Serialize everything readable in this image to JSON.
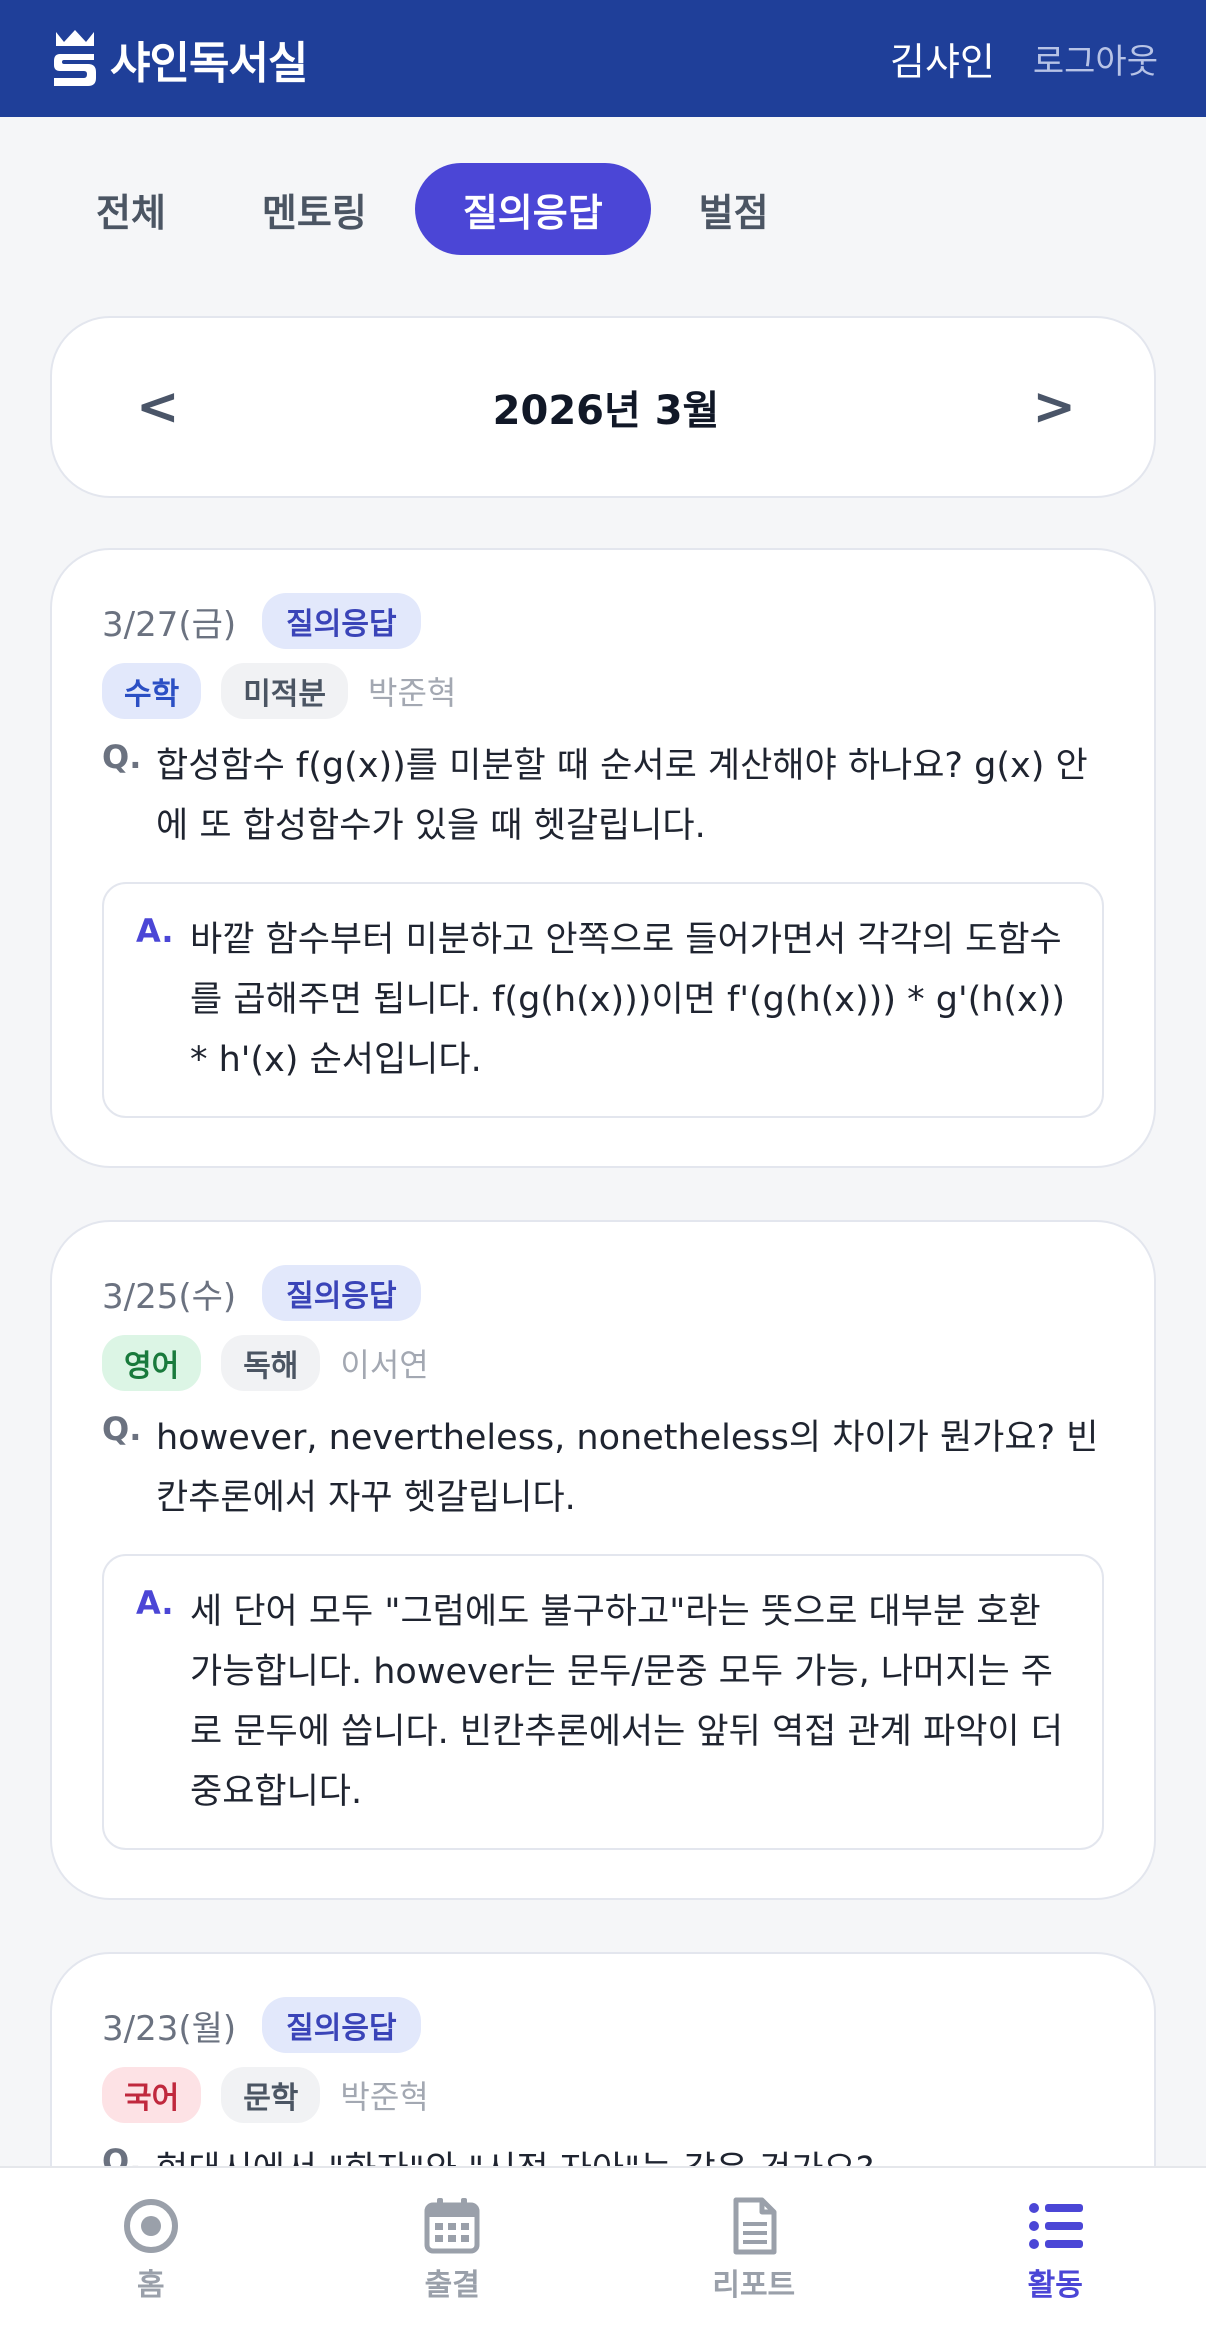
{
  "header": {
    "brand": "샤인독서실",
    "user_name": "김샤인",
    "logout": "로그아웃"
  },
  "tabs": [
    {
      "label": "전체",
      "active": false
    },
    {
      "label": "멘토링",
      "active": false
    },
    {
      "label": "질의응답",
      "active": true
    },
    {
      "label": "벌점",
      "active": false
    }
  ],
  "month": {
    "label": "2026년 3월",
    "prev": "<",
    "next": ">"
  },
  "cards": [
    {
      "date": "3/27(금)",
      "type": "질의응답",
      "subject": "수학",
      "topic": "미적분",
      "mentor": "박준혁",
      "q_mark": "Q.",
      "question": "합성함수 f(g(x))를 미분할 때 순서로 계산해야 하나요? g(x) 안에 또 합성함수가 있을 때 헷갈립니다.",
      "a_mark": "A.",
      "answer": "바깥 함수부터 미분하고 안쪽으로 들어가면서 각각의 도함수를 곱해주면 됩니다. f(g(h(x)))이면 f'(g(h(x))) * g'(h(x)) * h'(x) 순서입니다."
    },
    {
      "date": "3/25(수)",
      "type": "질의응답",
      "subject": "영어",
      "topic": "독해",
      "mentor": "이서연",
      "q_mark": "Q.",
      "question": "however, nevertheless, nonetheless의 차이가 뭔가요? 빈칸추론에서 자꾸 헷갈립니다.",
      "a_mark": "A.",
      "answer": "세 단어 모두 \"그럼에도 불구하고\"라는 뜻으로 대부분 호환 가능합니다. however는 문두/문중 모두 가능, 나머지는 주로 문두에 씁니다. 빈칸추론에서는 앞뒤 역접 관계 파악이 더 중요합니다."
    },
    {
      "date": "3/23(월)",
      "type": "질의응답",
      "subject": "국어",
      "topic": "문학",
      "mentor": "박준혁",
      "q_mark": "Q.",
      "question": "현대시에서 \"화자\"와 \"시적 자아\"는 같은 건가요?"
    }
  ],
  "bottom_nav": [
    {
      "label": "홈",
      "icon": "target-icon"
    },
    {
      "label": "출결",
      "icon": "calendar-icon"
    },
    {
      "label": "리포트",
      "icon": "document-icon"
    },
    {
      "label": "활동",
      "icon": "list-icon"
    }
  ],
  "colors": {
    "header_bg": "#1f3f99",
    "accent": "#4b46d6"
  }
}
